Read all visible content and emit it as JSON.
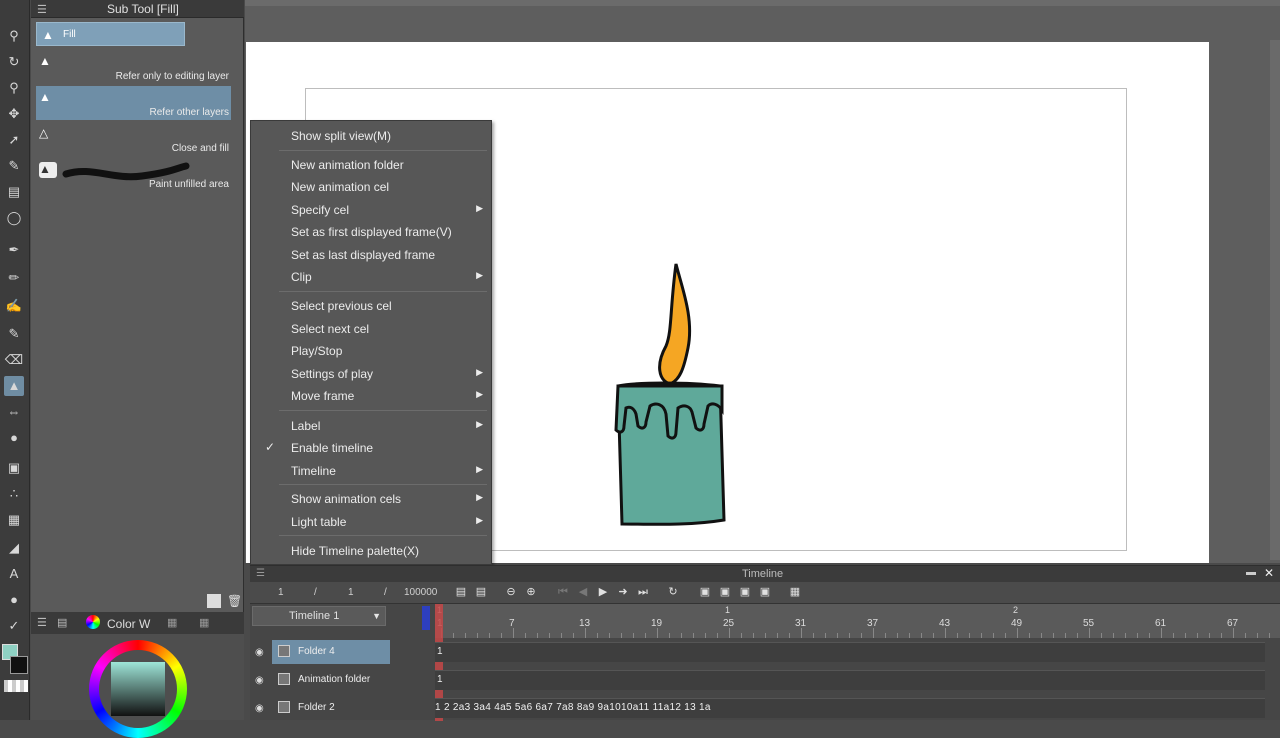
{
  "subtool": {
    "title": "Sub Tool [Fill]",
    "tab_label": "Fill",
    "items": [
      {
        "label": "Refer only to editing layer"
      },
      {
        "label": "Refer other layers"
      },
      {
        "label": "Close and fill"
      },
      {
        "label": "Paint unfilled area"
      }
    ]
  },
  "color_panel": {
    "tab_label": "Color W"
  },
  "context_menu": {
    "items": [
      {
        "label": "Show split view(M)"
      },
      {
        "label": "New animation folder"
      },
      {
        "label": "New animation cel"
      },
      {
        "label": "Specify cel"
      },
      {
        "label": "Set as first displayed frame(V)"
      },
      {
        "label": "Set as last displayed frame"
      },
      {
        "label": "Clip"
      },
      {
        "label": "Select previous cel"
      },
      {
        "label": "Select next cel"
      },
      {
        "label": "Play/Stop"
      },
      {
        "label": "Settings of play"
      },
      {
        "label": "Move frame"
      },
      {
        "label": "Label"
      },
      {
        "label": "Enable timeline"
      },
      {
        "label": "Timeline"
      },
      {
        "label": "Show animation cels"
      },
      {
        "label": "Light table"
      },
      {
        "label": "Hide Timeline palette(X)"
      }
    ],
    "checkmark": "✓"
  },
  "timeline": {
    "title": "Timeline",
    "counter_a": "1",
    "sep_a": "/",
    "counter_b": "1",
    "sep_b": "/",
    "counter_c": "100000",
    "dropdown_value": "Timeline 1",
    "ruler_major": [
      "1",
      "7",
      "13",
      "19",
      "25",
      "31",
      "37",
      "43",
      "49",
      "55",
      "61",
      "67"
    ],
    "ruler_sec": [
      "1",
      "1",
      "2"
    ],
    "layers": [
      {
        "name": "Folder 4",
        "marker": "1"
      },
      {
        "name": "Animation folder",
        "marker": "1"
      },
      {
        "name": "Folder 2",
        "cels": "1 2 2a3 3a4 4a5 5a6 6a7 7a8 8a9 9a1010a11 11a12 13 1a"
      }
    ]
  },
  "colors": {
    "accent": "#6e8ea6",
    "candle_body": "#5fa99a",
    "flame": "#f5a623",
    "playhead": "#c44848"
  }
}
